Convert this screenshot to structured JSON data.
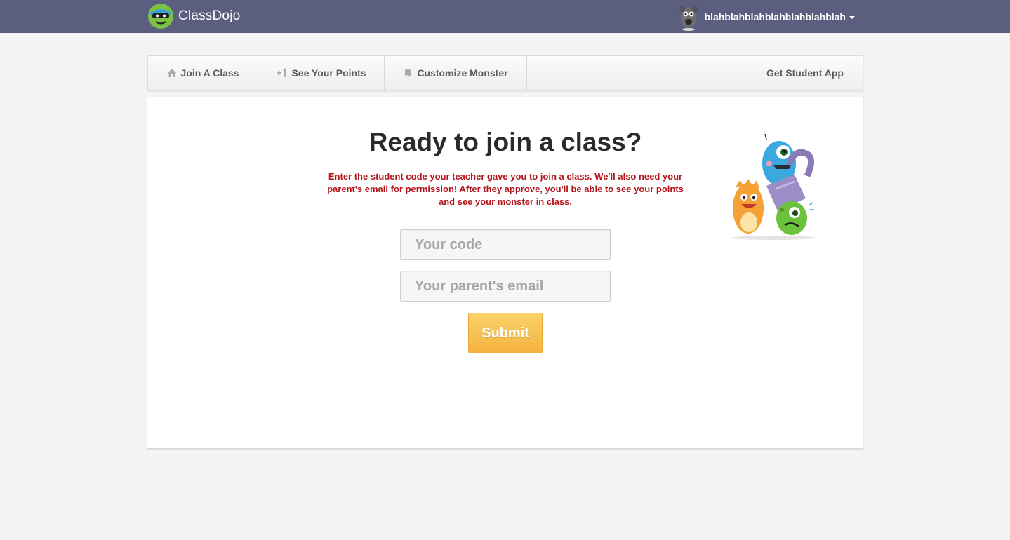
{
  "header": {
    "brand_name": "ClassDojo",
    "user_name": "blahblahblahblahblahblahblah",
    "bar_color": "#5b5e7e"
  },
  "nav": {
    "items": [
      {
        "label": "Join A Class",
        "icon": "home-icon"
      },
      {
        "label": "See Your Points",
        "icon": "plus-one-icon"
      },
      {
        "label": "Customize Monster",
        "icon": "monster-icon"
      }
    ],
    "app_label": "Get Student App"
  },
  "main": {
    "title": "Ready to join a class?",
    "instructions": "Enter the student code your teacher gave you to join a class. We'll also need your parent's email for permission! After they approve, you'll be able to see your points and see your monster in class.",
    "code_placeholder": "Your code",
    "email_placeholder": "Your parent's email",
    "submit_label": "Submit",
    "accent_color": "#f4b23f",
    "instructions_color": "#b3141b"
  }
}
